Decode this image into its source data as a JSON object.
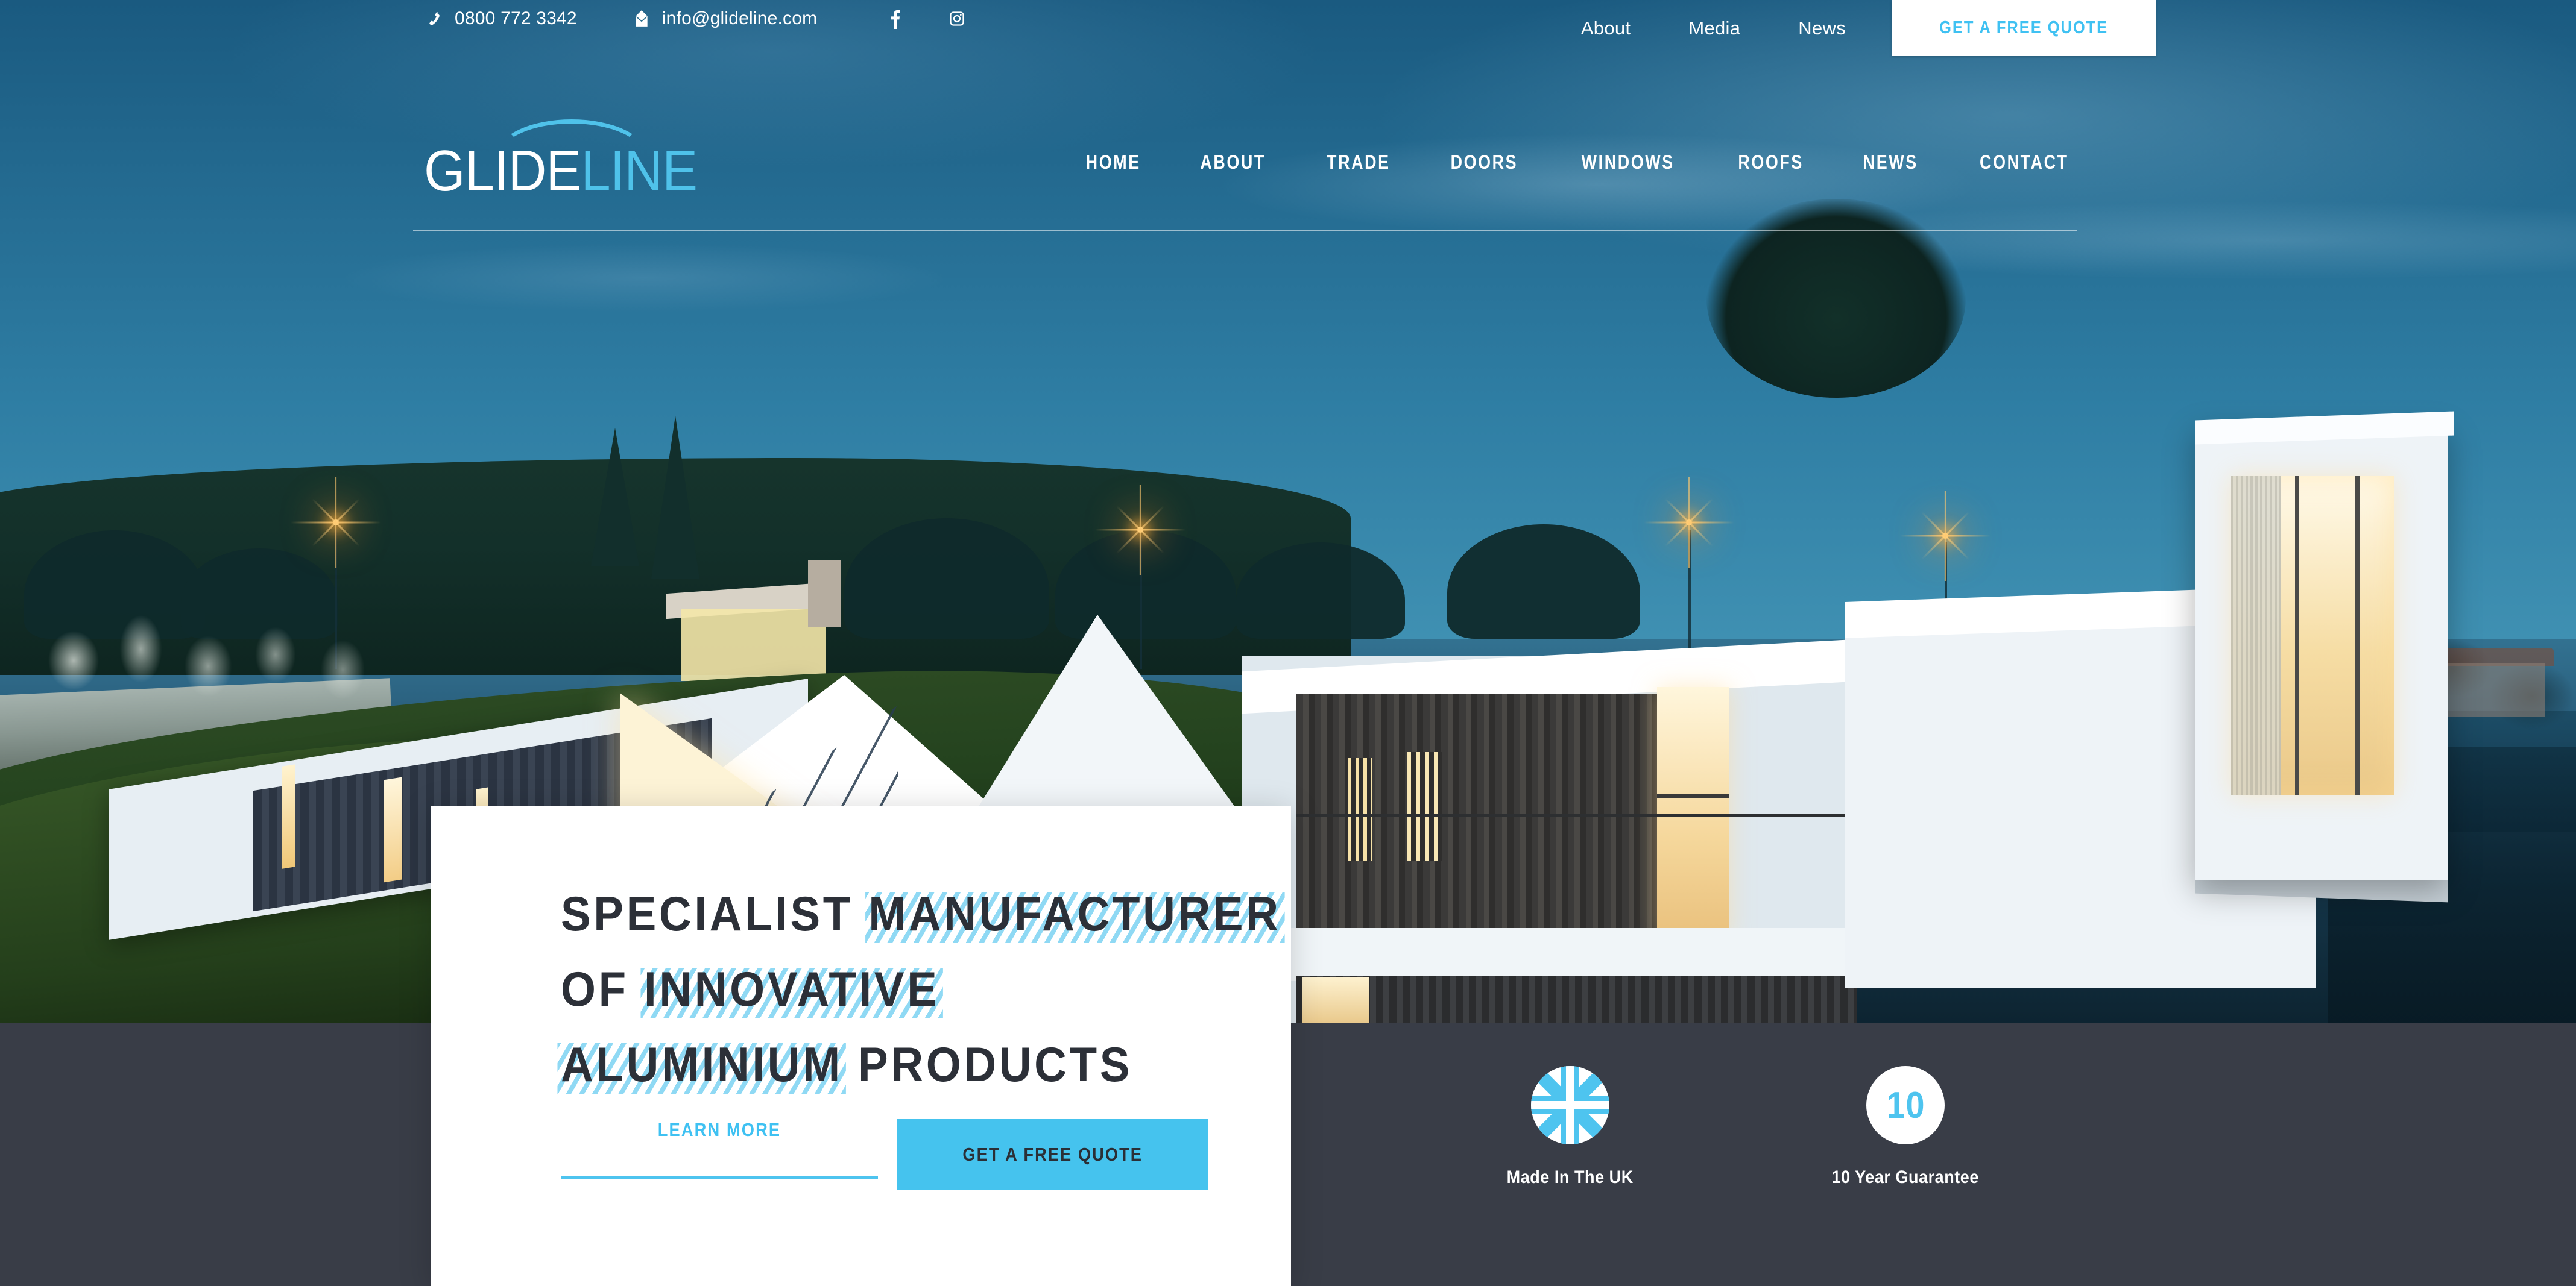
{
  "topbar": {
    "phone": "0800 772 3342",
    "email": "info@glideline.com",
    "phone_icon": "phone-icon",
    "email_icon": "envelope-icon",
    "facebook_icon": "facebook-icon",
    "instagram_icon": "instagram-icon",
    "links": [
      {
        "label": "About"
      },
      {
        "label": "Media"
      },
      {
        "label": "News"
      }
    ],
    "quote_button": "GET A FREE QUOTE"
  },
  "logo": {
    "part1": "GLIDE",
    "part2": "LINE",
    "arc_color": "#4fc2ea",
    "part1_color": "#ffffff",
    "part2_color": "#4fc2ea"
  },
  "mainnav": {
    "items": [
      {
        "label": "HOME"
      },
      {
        "label": "ABOUT"
      },
      {
        "label": "TRADE"
      },
      {
        "label": "DOORS"
      },
      {
        "label": "WINDOWS"
      },
      {
        "label": "ROOFS"
      },
      {
        "label": "NEWS"
      },
      {
        "label": "CONTACT"
      }
    ]
  },
  "hero": {
    "headline": {
      "line1_plain": "SPECIALIST ",
      "line1_mark": "MANUFACTURER",
      "line2_plain": "OF  ",
      "line2_mark": "INNOVATIVE",
      "line3_mark": "ALUMINIUM",
      "line3_plain": " PRODUCTS"
    },
    "learn_more": "LEARN MORE",
    "quote_button": "GET A FREE QUOTE"
  },
  "badges": [
    {
      "icon": "union-jack-icon",
      "label": "Made In The UK"
    },
    {
      "icon": "ten-year-icon",
      "value": "10",
      "label": "10 Year Guarantee"
    }
  ],
  "colors": {
    "accent_cyan": "#45c3ee",
    "dark_band": "#393d47",
    "headline_text": "#2c3038",
    "highlight_stripe": "#8fd9f4"
  }
}
